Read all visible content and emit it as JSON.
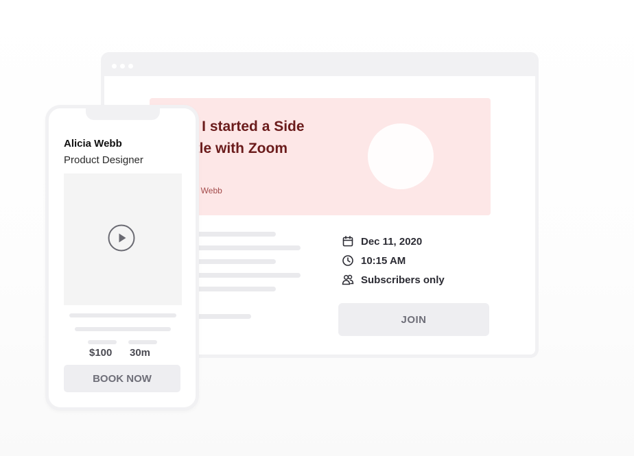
{
  "colors": {
    "hero_background": "#fde7e7",
    "hero_title": "#6b1c1c",
    "frame_gray": "#f1f1f3",
    "button_gray": "#eeeef1"
  },
  "browser": {
    "hero": {
      "title": "How I started a Side Hustle with Zoom",
      "author": "By Alicia Webb"
    },
    "event": {
      "date": "Dec 11, 2020",
      "time": "10:15 AM",
      "access": "Subscribers only",
      "date_icon": "calendar-icon",
      "time_icon": "clock-icon",
      "access_icon": "users-icon"
    },
    "join_label": "JOIN"
  },
  "phone": {
    "name": "Alicia Webb",
    "role": "Product Designer",
    "video_icon": "play-icon",
    "price": "$100",
    "duration": "30m",
    "book_label": "BOOK NOW"
  }
}
